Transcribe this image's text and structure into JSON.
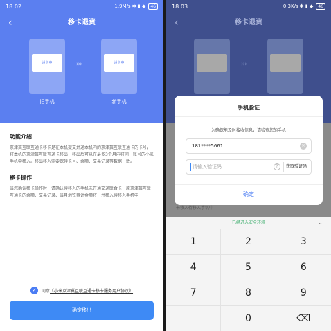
{
  "left": {
    "status": {
      "time": "18:02",
      "right": "1.9M/s ✱ ▮ ◆",
      "battery": "46"
    },
    "title": "移卡退资",
    "old_phone_screen": "设卡中",
    "old_phone_label": "旧手机",
    "new_phone_screen": "设卡中",
    "new_phone_label": "新手机",
    "section1_title": "功能介绍",
    "section1_body": "京津冀互联互通卡移卡是在本机提交并通本机内的京津冀互联互通卡的卡号，将本机的京津冀互联互通卡移出，移出后可以在最多3个月内将同一账号的小米手机中移入。移出移入需要保持卡号、余额、交易记录等数据一致。",
    "section2_title": "移卡操作",
    "section2_body": "当您确认移卡操作时，请确认待移入的手机未开通交通联合卡，原京津冀互联互通卡的余额、交易记录、当月地铁累计金额将一并移入待移入手机中",
    "agree_prefix": "同意",
    "agree_link": "《小米京津冀互联互通卡移卡服务用户协议》",
    "confirm_button": "确定移出"
  },
  "right": {
    "status": {
      "time": "18:03",
      "right": "0.3K/s ✱ ▮ ◆",
      "battery": "46"
    },
    "title": "移卡退资",
    "dialog": {
      "title": "手机验证",
      "hint": "为确保能及时接收信息，请检查您的手机",
      "phone": "181****5661",
      "code_placeholder": "请输入验证码",
      "get_code": "获取验证码",
      "confirm": "确定"
    },
    "ghost_text": "卡移入待移入手机中",
    "keyboard_banner": "已经进入安全环境",
    "keys": [
      "1",
      "2",
      "3",
      "4",
      "5",
      "6",
      "7",
      "8",
      "9",
      "",
      "0",
      "⌫"
    ]
  },
  "colors": {
    "primary": "#5b7ff0",
    "button": "#3e8af5",
    "safe": "#3fae6e"
  }
}
